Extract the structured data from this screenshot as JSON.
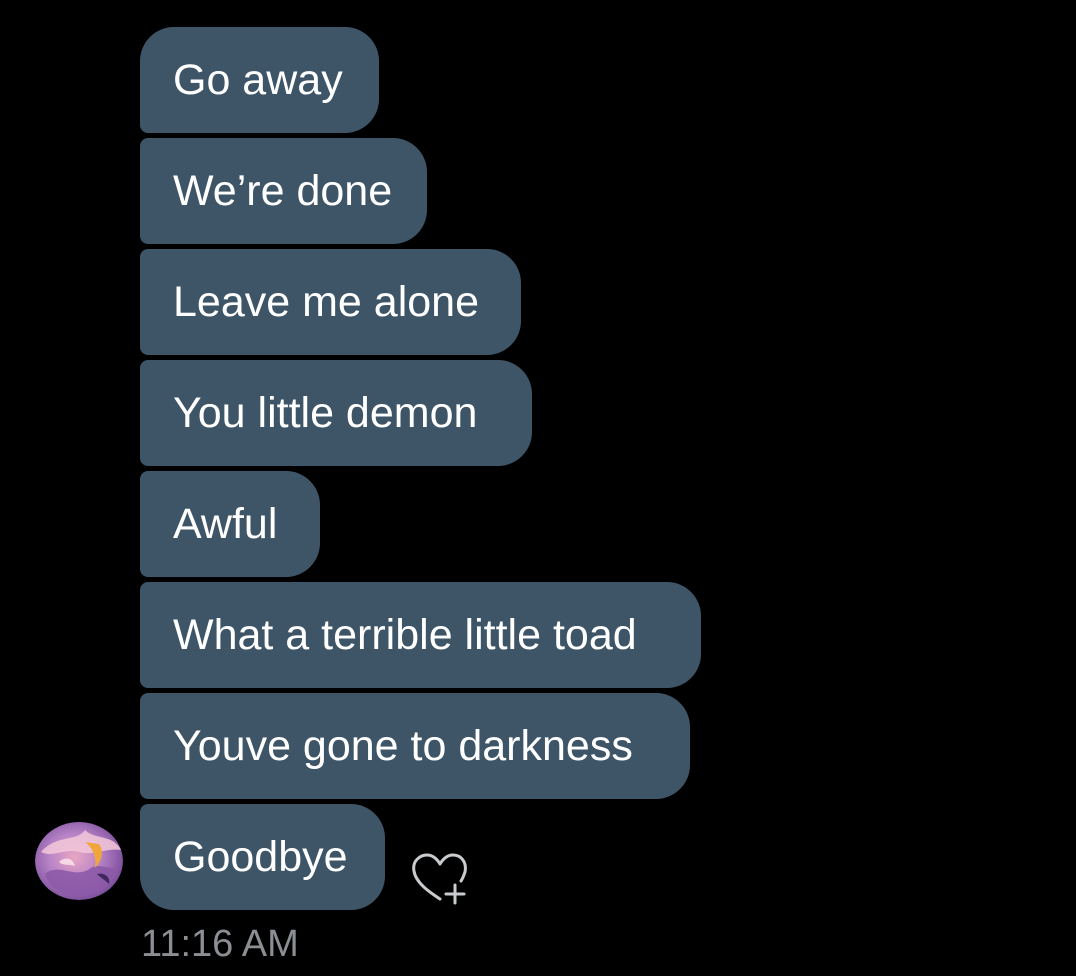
{
  "colors": {
    "background": "#000000",
    "bubble": "#3e5568",
    "bubble_text": "#ffffff",
    "timestamp": "#8b8f93",
    "icon": "#c9cccf"
  },
  "conversation": {
    "messages": [
      {
        "text": "Go away"
      },
      {
        "text": "We’re done"
      },
      {
        "text": "Leave me alone"
      },
      {
        "text": "You little demon"
      },
      {
        "text": "Awful"
      },
      {
        "text": "What a terrible little toad"
      },
      {
        "text": "Youve gone to darkness"
      },
      {
        "text": "Goodbye"
      }
    ],
    "timestamp": "11:16 AM",
    "sender_avatar_icon": "abstract-avatar-icon",
    "reaction_icon": "heart-plus-icon"
  }
}
